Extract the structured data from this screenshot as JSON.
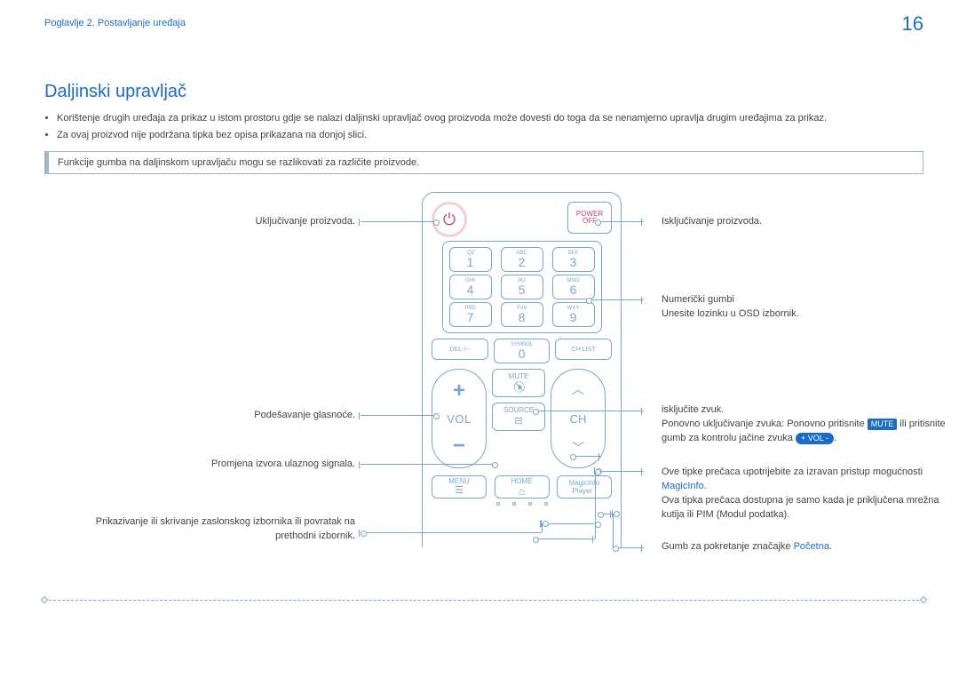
{
  "page_number": "16",
  "chapter": "Poglavlje 2. Postavljanje uređaja",
  "section_title": "Daljinski upravljač",
  "bullets": [
    "Korištenje drugih uređaja za prikaz u istom prostoru gdje se nalazi daljinski upravljač ovog proizvoda može dovesti do toga da se nenamjerno upravlja drugim uređajima za prikaz.",
    "Za ovaj proizvod nije podržana tipka bez opisa prikazana na donjoj slici."
  ],
  "note": "Funkcije gumba na daljinskom upravljaču mogu se razlikovati za različite proizvode.",
  "remote": {
    "power_off_top": "POWER",
    "power_off_bottom": "OFF",
    "numpad": [
      [
        {
          "l": ".QZ",
          "d": "1"
        },
        {
          "l": "ABC",
          "d": "2"
        },
        {
          "l": "DEF",
          "d": "3"
        }
      ],
      [
        {
          "l": "GHI",
          "d": "4"
        },
        {
          "l": "JKL",
          "d": "5"
        },
        {
          "l": "MNO",
          "d": "6"
        }
      ],
      [
        {
          "l": "PRS",
          "d": "7"
        },
        {
          "l": "TUV",
          "d": "8"
        },
        {
          "l": "WXY",
          "d": "9"
        }
      ]
    ],
    "del_label": "DEL-/--",
    "zero_top": "SYMBOL",
    "zero": "0",
    "chlist": "CH LIST",
    "vol_label": "VOL",
    "mute": "MUTE",
    "source": "SOURCE",
    "ch_label": "CH",
    "menu": "MENU",
    "home": "HOME",
    "magicinfo_top": "MagicInfo",
    "magicinfo_bottom": "Player I"
  },
  "callouts": {
    "power_on": "Uključivanje proizvoda.",
    "volume": "Podešavanje glasnoće.",
    "source": "Promjena izvora ulaznog signala.",
    "menu": "Prikazivanje ili skrivanje zaslonskog izbornika ili povratak na prethodni izbornik.",
    "power_off": "Isključivanje proizvoda.",
    "numeric_1": "Numerički gumbi",
    "numeric_2": "Unesite lozinku u OSD izbornik.",
    "mute_1": "isključite zvuk.",
    "mute_2a": "Ponovno uključivanje zvuka: Ponovno pritisnite ",
    "mute_pill": "MUTE",
    "mute_2b": " ili pritisnite gumb za kontrolu jačine zvuka ",
    "vol_pill": "+ VOL -",
    "mute_2c": ".",
    "magicinfo_1": "Ove tipke prečaca upotrijebite za izravan pristup mogućnosti ",
    "magicinfo_link": "MagicInfo",
    "magicinfo_2": "Ova tipka prečaca dostupna je samo kada je priključena mrežna kutija ili PIM (Modul podatka).",
    "home_1": "Gumb za pokretanje značajke ",
    "home_link": "Početna",
    "home_2": "."
  }
}
